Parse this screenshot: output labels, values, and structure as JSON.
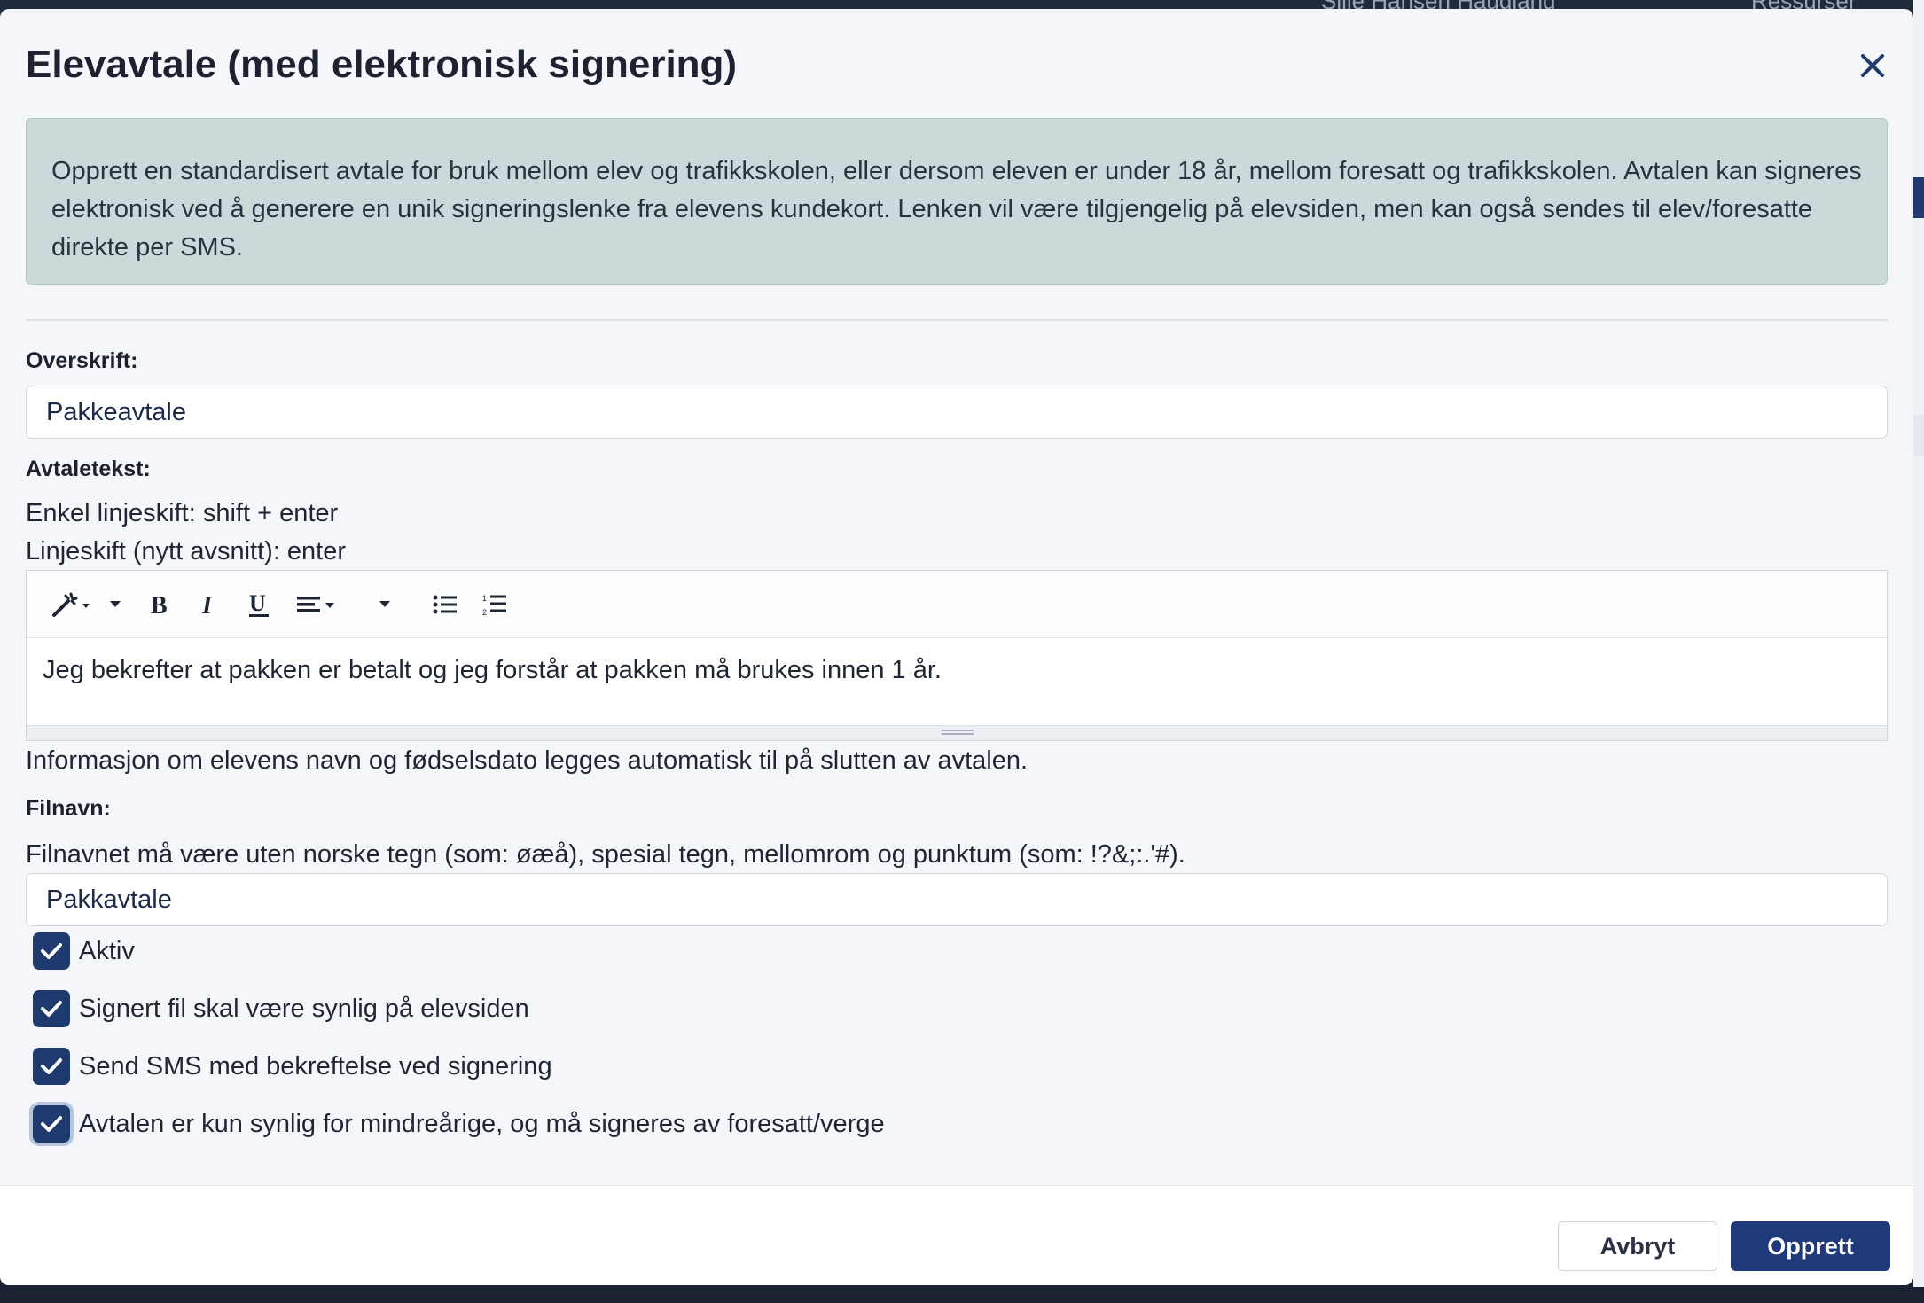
{
  "background": {
    "topbar_user": "Siile Hansen Haugland",
    "topbar_resources": "Ressurser"
  },
  "modal": {
    "title": "Elevavtale (med elektronisk signering)",
    "info_text": "Opprett en standardisert avtale for bruk mellom elev og trafikkskolen, eller dersom eleven er under 18 år, mellom foresatt og trafikkskolen. Avtalen kan signeres elektronisk ved å generere en unik signeringslenke fra elevens kundekort. Lenken vil være tilgjengelig på elevsiden, men kan også sendes til elev/foresatte direkte per SMS."
  },
  "form": {
    "heading_label": "Overskrift:",
    "heading_value": "Pakkeavtale",
    "agreement_label": "Avtaletekst:",
    "hint_line1": "Enkel linjeskift: shift + enter",
    "hint_line2": "Linjeskift (nytt avsnitt): enter",
    "editor_text": "Jeg bekrefter at pakken er betalt og jeg forstår at pakken må brukes innen 1 år.",
    "auto_info": "Informasjon om elevens navn og fødselsdato legges automatisk til på slutten av avtalen.",
    "filename_label": "Filnavn:",
    "filename_hint": "Filnavnet må være uten norske tegn (som: øæå), spesial tegn, mellomrom og punktum (som: !?&;:.'#).",
    "filename_value": "Pakkavtale"
  },
  "toolbar": {
    "icons": [
      "magic-wand-icon",
      "bold-icon",
      "italic-icon",
      "underline-icon",
      "align-icon",
      "unordered-list-icon",
      "ordered-list-icon"
    ]
  },
  "checkboxes": [
    {
      "label": "Aktiv",
      "checked": true
    },
    {
      "label": "Signert fil skal være synlig på elevsiden",
      "checked": true
    },
    {
      "label": "Send SMS med bekreftelse ved signering",
      "checked": true
    },
    {
      "label": "Avtalen er kun synlig for mindreårige, og må signeres av foresatt/verge",
      "checked": true
    }
  ],
  "footer": {
    "cancel_label": "Avbryt",
    "submit_label": "Opprett"
  },
  "colors": {
    "primary": "#1e3a7a",
    "info_bg": "#cbd9da",
    "modal_bg": "#f4f6f9"
  }
}
